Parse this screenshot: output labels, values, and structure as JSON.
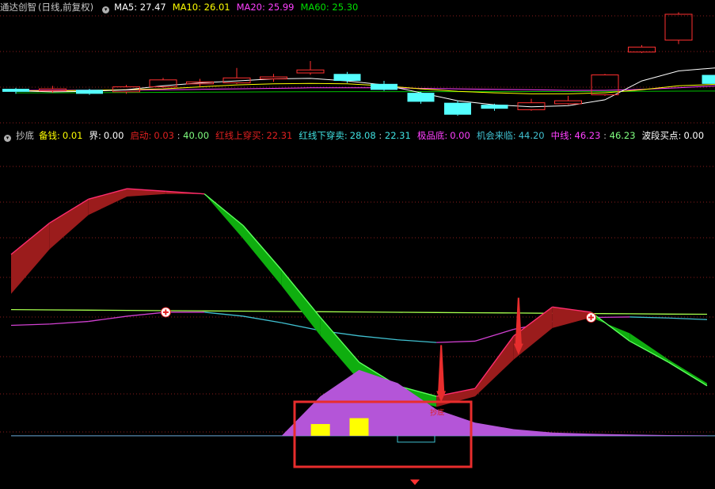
{
  "main_header": {
    "symbol": "通达创智",
    "period": "(日线,前复权)",
    "ma": [
      {
        "label": "MA5:",
        "value": "27.47",
        "color": "#ffffff"
      },
      {
        "label": "MA10:",
        "value": "26.01",
        "color": "#ffff00"
      },
      {
        "label": "MA20:",
        "value": "25.99",
        "color": "#ff40ff"
      },
      {
        "label": "MA60:",
        "value": "25.30",
        "color": "#00e000"
      }
    ]
  },
  "indicator_header": {
    "name": "抄底",
    "items": [
      {
        "label": "备钱:",
        "value": "0.01",
        "color": "#ffff00",
        "vcolor": "#ffff00"
      },
      {
        "label": "界:",
        "value": "0.00",
        "color": "#ffffff",
        "vcolor": "#ffffff"
      },
      {
        "label": "启动:",
        "value": "0.03",
        "value2": "40.00",
        "color": "#e02020",
        "vcolor": "#e02020",
        "v2color": "#80ff80"
      },
      {
        "label": "红线上穿买:",
        "value": "22.31",
        "color": "#e02020",
        "vcolor": "#e02020"
      },
      {
        "label": "红线下穿卖:",
        "value": "28.08",
        "value2": "22.31",
        "color": "#40e0e0",
        "vcolor": "#40e0e0",
        "v2color": "#40e0e0"
      },
      {
        "label": "极品底:",
        "value": "0.00",
        "color": "#ff40ff",
        "vcolor": "#ff40ff"
      },
      {
        "label": "机会来临:",
        "value": "44.20",
        "color": "#40c0d0",
        "vcolor": "#40c0d0"
      },
      {
        "label": "中线:",
        "value": "46.23",
        "value2": "46.23",
        "color": "#ff40ff",
        "vcolor": "#ff40ff",
        "v2color": "#80ff80"
      },
      {
        "label": "波段买点:",
        "value": "0.00",
        "color": "#ffffff",
        "vcolor": "#ffffff"
      }
    ]
  },
  "colors": {
    "up_candle": "#ff3030",
    "down_candle": "#54ffff",
    "ribbon_up": "#9b1c1c",
    "ribbon_up_edge": "#ff2d6f",
    "ribbon_down": "#0fae0f",
    "ribbon_down_edge": "#5cff5c",
    "midline": "#a6ff4d",
    "opportunity_cyan": "#40c0d0",
    "opportunity_magenta": "#d040d0",
    "hump": "#b455d8",
    "highlight_box": "#e82d2d",
    "yellow_bar": "#ffff00",
    "arrow": "#e82d2d"
  },
  "chart_data": [
    {
      "type": "candlestick",
      "title": "",
      "price_range": [
        22.0,
        33.0
      ],
      "candles": [
        {
          "o": 25.5,
          "c": 25.2,
          "h": 25.6,
          "l": 25.0
        },
        {
          "o": 25.3,
          "c": 25.5,
          "h": 25.8,
          "l": 25.1
        },
        {
          "o": 25.4,
          "c": 25.0,
          "h": 25.5,
          "l": 24.9
        },
        {
          "o": 25.2,
          "c": 25.7,
          "h": 25.9,
          "l": 25.0
        },
        {
          "o": 25.7,
          "c": 26.4,
          "h": 26.6,
          "l": 25.6
        },
        {
          "o": 26.0,
          "c": 26.2,
          "h": 26.5,
          "l": 25.7
        },
        {
          "o": 26.1,
          "c": 26.6,
          "h": 27.6,
          "l": 26.0
        },
        {
          "o": 26.5,
          "c": 26.7,
          "h": 27.0,
          "l": 26.2
        },
        {
          "o": 27.1,
          "c": 27.4,
          "h": 28.3,
          "l": 26.9
        },
        {
          "o": 27.0,
          "c": 26.3,
          "h": 27.2,
          "l": 26.1
        },
        {
          "o": 26.0,
          "c": 25.4,
          "h": 26.3,
          "l": 25.3
        },
        {
          "o": 25.1,
          "c": 24.2,
          "h": 25.2,
          "l": 24.0
        },
        {
          "o": 24.1,
          "c": 22.9,
          "h": 24.3,
          "l": 22.8
        },
        {
          "o": 23.9,
          "c": 23.5,
          "h": 24.0,
          "l": 23.3
        },
        {
          "o": 23.4,
          "c": 24.1,
          "h": 24.5,
          "l": 23.3
        },
        {
          "o": 24.0,
          "c": 24.3,
          "h": 24.8,
          "l": 23.9
        },
        {
          "o": 24.9,
          "c": 26.9,
          "h": 27.0,
          "l": 24.8
        },
        {
          "o": 29.2,
          "c": 29.7,
          "h": 29.9,
          "l": 29.1
        },
        {
          "o": 30.4,
          "c": 33.0,
          "h": 33.2,
          "l": 30.0
        },
        {
          "o": 26.9,
          "c": 26.0,
          "h": 27.5,
          "l": 25.9
        },
        {
          "o": 26.3,
          "c": 26.5,
          "h": 27.2,
          "l": 26.1
        },
        {
          "o": 26.2,
          "c": 25.5,
          "h": 26.3,
          "l": 25.3
        }
      ],
      "ma5": [
        25.3,
        25.2,
        25.25,
        25.4,
        25.8,
        26.1,
        26.3,
        26.5,
        26.55,
        26.3,
        25.9,
        25.1,
        24.3,
        23.9,
        23.7,
        23.8,
        24.4,
        26.3,
        27.3,
        27.6,
        27.7,
        27.47
      ],
      "ma10": [
        25.3,
        25.3,
        25.35,
        25.4,
        25.5,
        25.7,
        25.9,
        26.0,
        26.05,
        26.0,
        25.8,
        25.5,
        25.25,
        25.1,
        25.0,
        25.0,
        25.1,
        25.4,
        25.8,
        25.95,
        26.0,
        26.01
      ],
      "ma20": [
        25.35,
        25.35,
        25.36,
        25.38,
        25.4,
        25.45,
        25.5,
        25.55,
        25.6,
        25.6,
        25.6,
        25.55,
        25.5,
        25.45,
        25.4,
        25.35,
        25.35,
        25.45,
        25.6,
        25.8,
        25.9,
        25.99
      ],
      "ma60": [
        25.1,
        25.1,
        25.12,
        25.13,
        25.15,
        25.17,
        25.18,
        25.2,
        25.21,
        25.22,
        25.22,
        25.22,
        25.22,
        25.22,
        25.23,
        25.23,
        25.24,
        25.25,
        25.27,
        25.28,
        25.29,
        25.3
      ]
    },
    {
      "type": "area",
      "title": "抄底",
      "ylim": [
        -10,
        110
      ],
      "x": [
        0,
        1,
        2,
        3,
        4,
        5,
        6,
        7,
        8,
        9,
        10,
        11,
        12,
        13,
        14,
        15,
        16,
        17,
        18,
        19,
        20,
        21
      ],
      "ribbon_a": [
        69,
        81,
        90,
        94,
        93,
        92,
        80,
        63,
        45,
        28,
        19,
        15,
        18,
        38,
        49,
        47,
        36,
        28,
        19
      ],
      "ribbon_b": [
        54,
        71,
        84,
        91,
        92,
        92,
        75,
        57,
        38,
        21,
        15,
        11,
        15,
        29,
        41,
        45,
        39,
        29,
        20
      ],
      "midline": [
        48.0,
        47.9,
        47.8,
        47.7,
        47.6,
        47.5,
        47.4,
        47.3,
        47.2,
        47.1,
        47.0,
        46.9,
        46.8,
        46.7,
        46.6,
        46.5,
        46.4,
        46.3,
        46.23
      ],
      "opportunity": [
        42.0,
        42.5,
        43.5,
        45.5,
        47.0,
        47.0,
        45.5,
        43.0,
        40.0,
        38.0,
        36.5,
        35.5,
        36.0,
        40.5,
        43.5,
        45.0,
        45.2,
        44.8,
        44.2
      ],
      "hump": [
        0,
        0,
        0,
        0,
        0,
        0,
        0,
        0,
        6,
        10,
        8,
        4,
        2,
        1,
        0.5,
        0.3,
        0.2,
        0.1,
        0.05
      ],
      "bars": [
        {
          "x": 8,
          "value": 4
        },
        {
          "x": 9,
          "value": 6
        }
      ],
      "buy_markers": [
        4,
        15
      ],
      "arrows": [
        11,
        13
      ],
      "bottom_label": "抄底"
    }
  ]
}
